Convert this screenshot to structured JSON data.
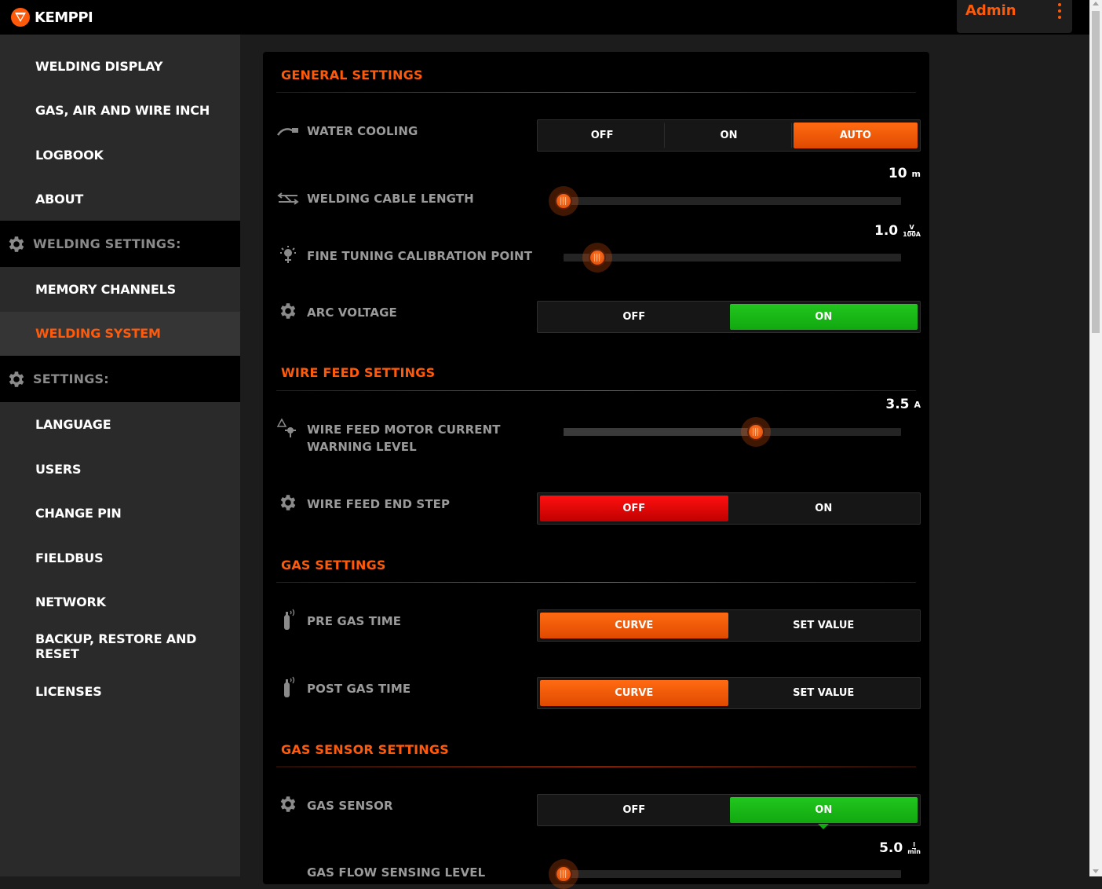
{
  "brand": {
    "name": "KEMPPI"
  },
  "user": {
    "name": "Admin"
  },
  "sidebar": {
    "items_top": [
      {
        "label": "WELDING DISPLAY"
      },
      {
        "label": "GAS, AIR AND WIRE INCH"
      },
      {
        "label": "LOGBOOK"
      },
      {
        "label": "ABOUT"
      }
    ],
    "group_welding": {
      "label": "WELDING SETTINGS:"
    },
    "items_welding": [
      {
        "label": "MEMORY CHANNELS"
      },
      {
        "label": "WELDING SYSTEM"
      }
    ],
    "group_settings": {
      "label": "SETTINGS:"
    },
    "items_settings": [
      {
        "label": "LANGUAGE"
      },
      {
        "label": "USERS"
      },
      {
        "label": "CHANGE PIN"
      },
      {
        "label": "FIELDBUS"
      },
      {
        "label": "NETWORK"
      },
      {
        "label": "BACKUP, RESTORE AND RESET"
      },
      {
        "label": "LICENSES"
      }
    ]
  },
  "sections": {
    "general": {
      "title": "GENERAL SETTINGS"
    },
    "wire": {
      "title": "WIRE FEED SETTINGS"
    },
    "gas": {
      "title": "GAS SETTINGS"
    },
    "gas_sensor": {
      "title": "GAS SENSOR SETTINGS"
    }
  },
  "settings": {
    "water_cooling": {
      "label": "WATER COOLING",
      "options": [
        "OFF",
        "ON",
        "AUTO"
      ],
      "selected": "AUTO"
    },
    "cable_length": {
      "label": "WELDING CABLE LENGTH",
      "value": "10",
      "unit": "m",
      "level": 0.0
    },
    "fine_tuning": {
      "label": "FINE TUNING CALIBRATION POINT",
      "value": "1.0",
      "unit_num": "V",
      "unit_den": "100A",
      "level": 0.1
    },
    "arc_voltage": {
      "label": "ARC VOLTAGE",
      "options": [
        "OFF",
        "ON"
      ],
      "selected": "ON"
    },
    "wire_motor_current": {
      "label_line1": "WIRE FEED MOTOR CURRENT",
      "label_line2": "WARNING LEVEL",
      "value": "3.5",
      "unit": "A",
      "level": 0.57
    },
    "wire_end_step": {
      "label": "WIRE FEED END STEP",
      "options": [
        "OFF",
        "ON"
      ],
      "selected": "OFF"
    },
    "pre_gas": {
      "label": "PRE GAS TIME",
      "options": [
        "CURVE",
        "SET VALUE"
      ],
      "selected": "CURVE"
    },
    "post_gas": {
      "label": "POST GAS TIME",
      "options": [
        "CURVE",
        "SET VALUE"
      ],
      "selected": "CURVE"
    },
    "gas_sensor": {
      "label": "GAS SENSOR",
      "options": [
        "OFF",
        "ON"
      ],
      "selected": "ON"
    },
    "gas_flow_level": {
      "label": "GAS FLOW SENSING LEVEL",
      "value": "5.0",
      "unit_num": "l",
      "unit_den": "min",
      "level": 0.0
    }
  },
  "colors": {
    "accent": "#ff5a0a",
    "on": "#11a810",
    "off_alert": "#d00000"
  },
  "icons": {
    "gear": "gear-icon",
    "water": "water-cooling-icon",
    "cable": "cable-length-icon",
    "calibration": "calibration-icon",
    "warning": "warning-icon",
    "gas_bottle": "gas-bottle-icon"
  }
}
